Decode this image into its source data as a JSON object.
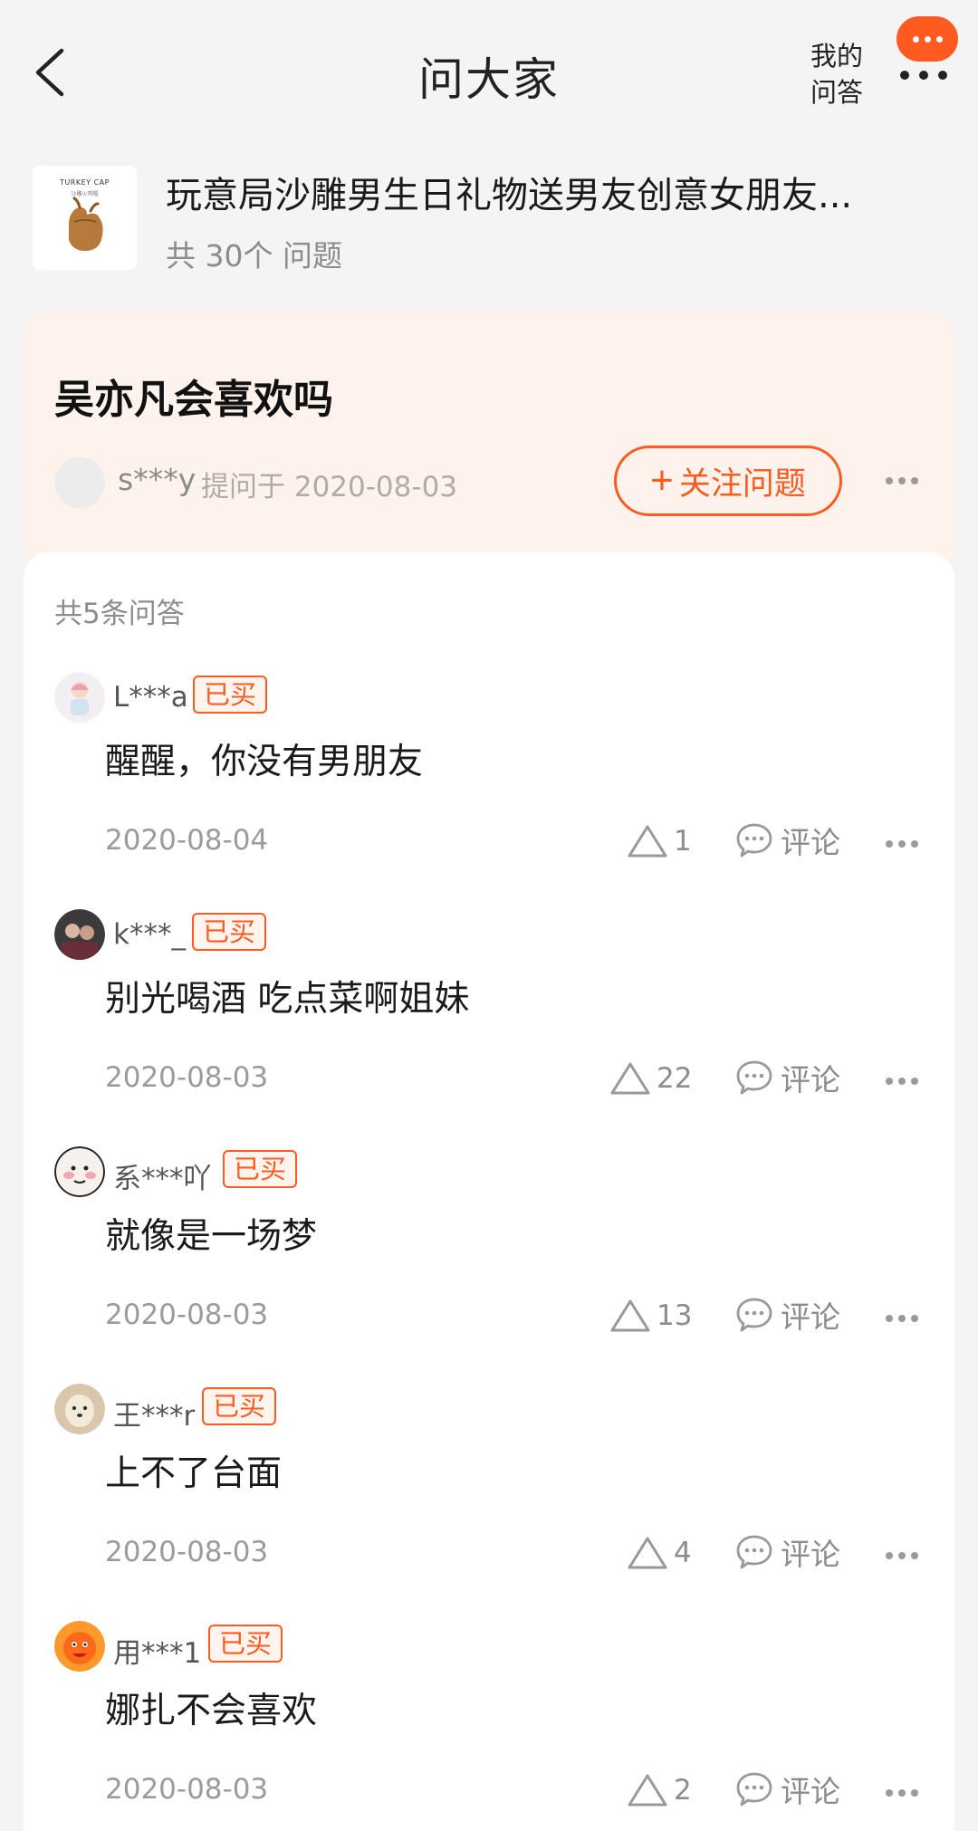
{
  "nav": {
    "title": "问大家",
    "my_qa_line1": "我的",
    "my_qa_line2": "问答"
  },
  "product": {
    "thumb_brand": "TURKEY CAP",
    "thumb_sub": "沙雕火鸡帽",
    "title": "玩意局沙雕男生日礼物送男友创意女朋友...",
    "count": "共 30个 问题"
  },
  "question": {
    "text": "吴亦凡会喜欢吗",
    "asker": "s***y",
    "asked_at": "提问于 2020-08-03",
    "follow_label": "关注问题"
  },
  "answers_count": "共5条问答",
  "answers": [
    {
      "user": "L***a",
      "badge": "已买",
      "text": "醒醒，你没有男朋友",
      "date": "2020-08-04",
      "likes": "1",
      "comment_label": "评论",
      "avatar_color": "#f3eef2"
    },
    {
      "user": "k***_",
      "badge": "已买",
      "text": "别光喝酒 吃点菜啊姐妹",
      "date": "2020-08-03",
      "likes": "22",
      "comment_label": "评论",
      "avatar_color": "#3d3a3c"
    },
    {
      "user": "系***吖",
      "badge": "已买",
      "text": "就像是一场梦",
      "date": "2020-08-03",
      "likes": "13",
      "comment_label": "评论",
      "avatar_color": "#f6f1ec"
    },
    {
      "user": "王***r",
      "badge": "已买",
      "text": "上不了台面",
      "date": "2020-08-03",
      "likes": "4",
      "comment_label": "评论",
      "avatar_color": "#d9c6ad"
    },
    {
      "user": "用***1",
      "badge": "已买",
      "text": "娜扎不会喜欢",
      "date": "2020-08-03",
      "likes": "2",
      "comment_label": "评论",
      "avatar_color": "#ff7a1a"
    }
  ],
  "colors": {
    "accent": "#ff5a1f",
    "question_bg": "#fdf3ec",
    "page_bg": "#f4f4f4"
  }
}
